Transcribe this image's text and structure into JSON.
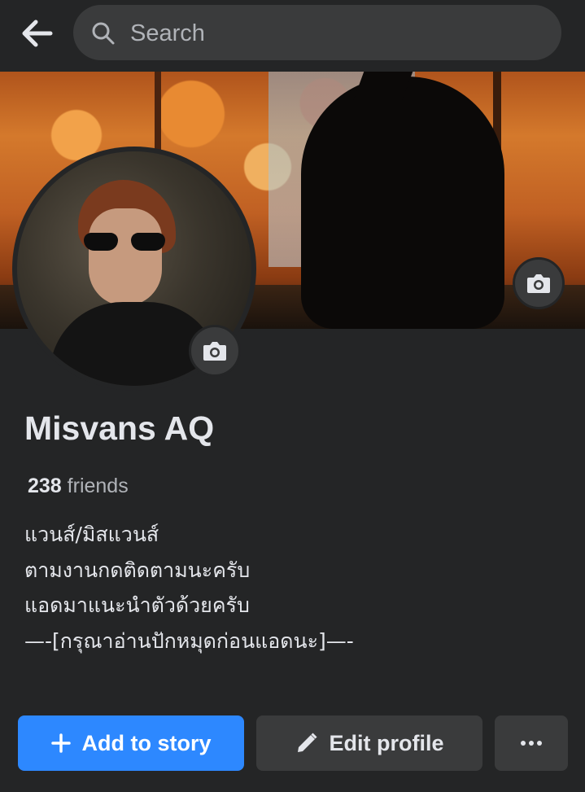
{
  "header": {
    "back_icon": "arrow-left-icon",
    "search_icon": "search-icon",
    "search_placeholder": "Search"
  },
  "profile": {
    "name": "Misvans AQ",
    "friends_count": "238",
    "friends_label": "friends",
    "bio": [
      "แวนส์/มิสแวนส์",
      "ตามงานกดติดตามนะครับ",
      "แอดมาแนะนำตัวด้วยครับ",
      "—-[กรุณาอ่านปักหมุดก่อนแอดนะ]—-"
    ]
  },
  "actions": {
    "add_story_label": "Add to story",
    "edit_profile_label": "Edit profile"
  },
  "colors": {
    "background": "#242526",
    "search_field": "#3a3b3c",
    "primary_button": "#2d88ff",
    "secondary_button": "#3a3b3c",
    "text_primary": "#e4e6eb",
    "text_secondary": "#b0b3b8"
  }
}
